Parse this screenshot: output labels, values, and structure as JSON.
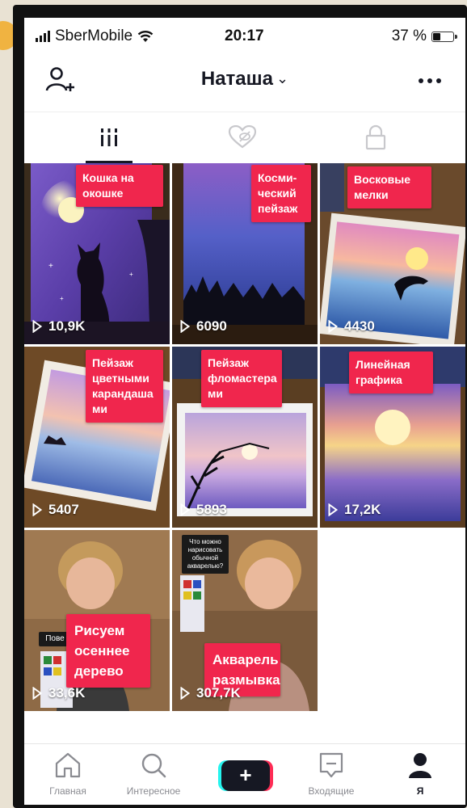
{
  "status_bar": {
    "carrier": "SberMobile",
    "time": "20:17",
    "battery": "37 %"
  },
  "header": {
    "username": "Наташа",
    "chevron": "⌄"
  },
  "tabs": [
    {
      "name": "videos",
      "icon": "grid-icon",
      "active": true
    },
    {
      "name": "liked",
      "icon": "heart-hidden-icon",
      "active": false
    },
    {
      "name": "private",
      "icon": "lock-icon",
      "active": false
    }
  ],
  "videos": [
    {
      "label": "Кошка на окошке",
      "views": "10,9K"
    },
    {
      "label": "Косми-ческий пейзаж",
      "views": "6090"
    },
    {
      "label": "Восковые мелки",
      "views": "4430"
    },
    {
      "label": "Пейзаж цветными карандаша ми",
      "views": "5407"
    },
    {
      "label": "Пейзаж фломастера ми",
      "views": "5893"
    },
    {
      "label": "Линейная графика",
      "views": "17,2K"
    },
    {
      "label": "Рисуем осеннее дерево",
      "views": "33,6K",
      "overlay_note": "Пове"
    },
    {
      "label": "Акварель размывка",
      "views": "307,7K",
      "overlay_note": "Что можно нарисовать обычной акварелью?"
    }
  ],
  "bottom_nav": {
    "home": "Главная",
    "discover": "Интересное",
    "create": "+",
    "inbox": "Входящие",
    "me": "Я"
  },
  "colors": {
    "accent_red": "#f0264d",
    "tiktok_cyan": "#25f4ee",
    "tiktok_pink": "#fe2c55"
  }
}
